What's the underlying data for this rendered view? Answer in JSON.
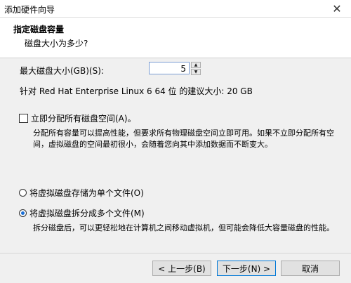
{
  "window": {
    "title": "添加硬件向导"
  },
  "header": {
    "title": "指定磁盘容量",
    "subtitle": "磁盘大小为多少?"
  },
  "size": {
    "label": "最大磁盘大小(GB)(S):",
    "value": "5",
    "recommendation": "针对 Red Hat Enterprise Linux 6 64 位 的建议大小: 20 GB"
  },
  "allocate": {
    "label": "立即分配所有磁盘空间(A)。",
    "checked": false,
    "description": "分配所有容量可以提高性能，但要求所有物理磁盘空间立即可用。如果不立即分配所有空间，虚拟磁盘的空间最初很小，会随着您向其中添加数据而不断变大。"
  },
  "storage": {
    "single_label": "将虚拟磁盘存储为单个文件(O)",
    "multi_label": "将虚拟磁盘拆分成多个文件(M)",
    "selected": "multi",
    "multi_description": "拆分磁盘后，可以更轻松地在计算机之间移动虚拟机，但可能会降低大容量磁盘的性能。"
  },
  "buttons": {
    "back": "< 上一步(B)",
    "next": "下一步(N) >",
    "cancel": "取消"
  },
  "colors": {
    "accent": "#0078d7",
    "radio_dot": "#1a6fd6"
  }
}
